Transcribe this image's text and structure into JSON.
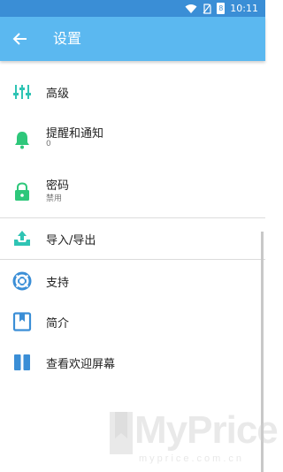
{
  "status_bar": {
    "time": "10:11",
    "battery": "8"
  },
  "app_bar": {
    "title": "设置"
  },
  "menu": {
    "advanced": {
      "label": "高级"
    },
    "reminders": {
      "label": "提醒和通知",
      "value": "0"
    },
    "password": {
      "label": "密码",
      "value": "禁用"
    },
    "import_export": {
      "label": "导入/导出"
    },
    "support": {
      "label": "支持"
    },
    "intro": {
      "label": "简介"
    },
    "welcome": {
      "label": "查看欢迎屏幕"
    }
  },
  "watermark": {
    "text": "MyPrice",
    "url": "myprice.com.cn"
  },
  "colors": {
    "statusbar": "#3a8ed6",
    "appbar": "#5bb8f0",
    "teal": "#2fc4b4",
    "green": "#2ec77a",
    "blue": "#3a8ed6"
  }
}
